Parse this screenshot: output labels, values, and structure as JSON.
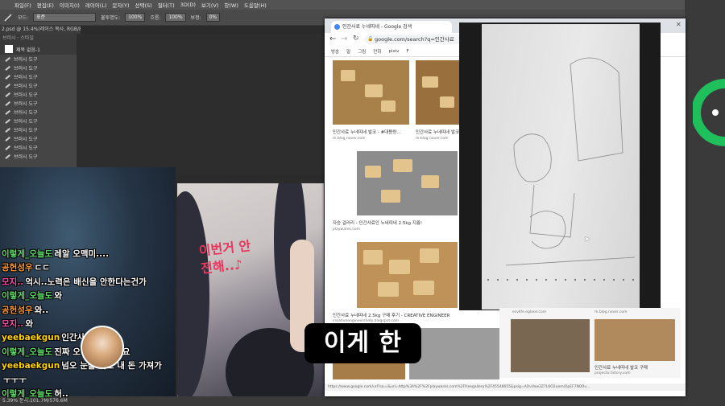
{
  "photoshop": {
    "menu": [
      "파일(F)",
      "편집(E)",
      "이미지(I)",
      "레이어(L)",
      "문자(Y)",
      "선택(S)",
      "필터(T)",
      "3D(D)",
      "보기(V)",
      "창(W)",
      "도움말(H)"
    ],
    "options": {
      "mode_label": "모드:",
      "mode_value": "표준",
      "opacity_label": "불투명도:",
      "opacity_value": "100%",
      "flow_label": "흐름:",
      "flow_value": "100%",
      "smoothing_label": "보정:",
      "smoothing_value": "0%"
    },
    "doc_tab": "2.psd @ 15.4%(레이스 복사, RGB/8) *",
    "tool_tabs": "브러시 · 스타일",
    "tool_items": {
      "first": "제목 없음-1",
      "item_label": "브러시 도구"
    },
    "status": "5.39%     문서:101.7M/576.6M"
  },
  "browser": {
    "tab_title": "인간사료 누네띠네 - Google 검색",
    "url": "google.com/search?q=인간사료",
    "bookmarks": [
      "방송",
      "말",
      "그림",
      "만화",
      "pixiv",
      "F"
    ],
    "results": [
      {
        "caption": "인간사료 누네띠네 발코 - #대용량...",
        "source": "m.blog.naver.com"
      },
      {
        "caption": "인간사료 누네띠네 발코",
        "source": "m.blog.naver.com"
      },
      {
        "caption": "자승 걸러리 - 인간사료인 누네띠네 2.5kg 지름!",
        "source": "playwares.com"
      },
      {
        "caption": "인간사료 누네띠네 2.5kg 구매 후기 - CREATIVE ENGINEER",
        "source": "creativeengineershelp.blogspot.com"
      },
      {
        "caption": "인간사료 누네띠네 발코 구매",
        "source": "projecto.tistory.com"
      }
    ],
    "right_sources": [
      "ecvlife.egloos.com",
      "m.blog.naver.com"
    ],
    "status_url": "https://www.google.com/url?sa=i&url=http%3A%2F%2Fplaywares.com%2Ffreegallery%2F45548655&psig=AOvVaw3Z7L6O2uemiOpEF7N0Ou..."
  },
  "chat": [
    {
      "user": "이렇게_오늘도",
      "msg": "레알 오맥미....",
      "color": "#5ee06a"
    },
    {
      "user": "공헌성우",
      "msg": "ㄷㄷ",
      "color": "#ff9a3c"
    },
    {
      "user": "모지..",
      "msg": "억시..노력은 배신을 안한다는건가",
      "color": "#ff4fb0"
    },
    {
      "user": "이렇게_오늘도",
      "msg": "와",
      "color": "#5ee06a"
    },
    {
      "user": "공헌성우",
      "msg": "와..",
      "color": "#ff9a3c"
    },
    {
      "user": "모지..",
      "msg": "와",
      "color": "#ff4fb0"
    },
    {
      "user": "yeebaekgun",
      "msg": "인간사",
      "color": "#ffd400"
    },
    {
      "user": "이렇게_오늘도",
      "msg": "진짜 오렌만 하셨네요",
      "color": "#5ee06a"
    },
    {
      "user": "yeebaekgun",
      "msg": "넘오 눈을 켜고 내 돈 가져가",
      "color": "#ffd400"
    },
    {
      "user": "",
      "msg": "ㅜㅜㅜ",
      "color": "#ffffff"
    },
    {
      "user": "이렇게_오늘도",
      "msg": "허..",
      "color": "#5ee06a"
    }
  ],
  "art_text": "이번거 안전해..♪",
  "subtitle": "이게 한",
  "icons": [
    "brush-icon",
    "chrome-back-icon",
    "chrome-forward-icon",
    "reload-icon",
    "lock-icon",
    "new-tab-icon",
    "close-icon",
    "cursor-icon",
    "color-wheel-icon"
  ],
  "colors": {
    "ps_bg": "#2b2b2b",
    "chrome_tab": "#dee1e6",
    "subtitle_bg": "#000000",
    "accent_red": "#e63a2b"
  }
}
